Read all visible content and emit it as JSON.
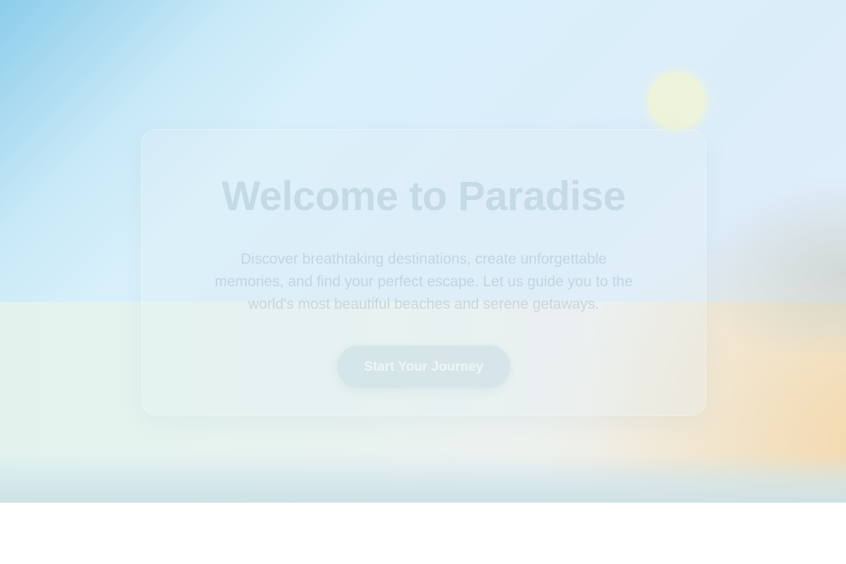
{
  "hero": {
    "title": "Welcome to Paradise",
    "description": "Discover breathtaking destinations, create unforgettable memories, and find your perfect escape. Let us guide you to the world's most beautiful beaches and serene getaways.",
    "cta_label": "Start Your Journey"
  },
  "colors": {
    "sky": "#8ccdeb",
    "sand": "#f2e3c4",
    "sun": "#eef4dc"
  }
}
